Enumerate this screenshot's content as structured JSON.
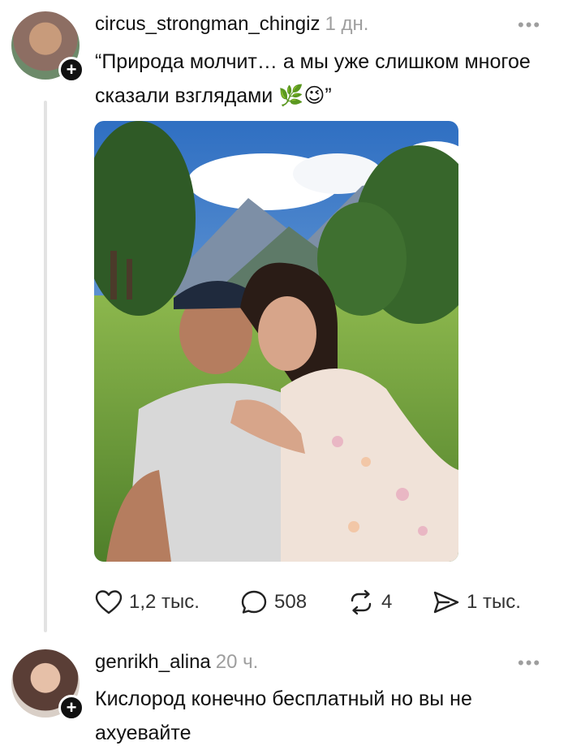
{
  "posts": [
    {
      "username": "circus_strongman_chingiz",
      "time": "1 дн.",
      "text": "“Природа молчит… а мы уже слишком многое сказали взглядами 🌿😉”",
      "actions": {
        "likes": "1,2 тыс.",
        "comments": "508",
        "reposts": "4",
        "shares": "1 тыс."
      }
    },
    {
      "username": "genrikh_alina",
      "time": "20 ч.",
      "text": "Кислород конечно бесплатный но вы не ахуевайте"
    }
  ],
  "icons": {
    "more": "more-options-icon",
    "follow": "plus-icon",
    "like": "heart-icon",
    "comment": "comment-bubble-icon",
    "repost": "repost-icon",
    "share": "send-icon"
  },
  "colors": {
    "text": "#111111",
    "muted": "#9e9e9e",
    "thread": "#e3e3e3"
  },
  "glyphs": {
    "more": "•••",
    "plus": "+"
  }
}
